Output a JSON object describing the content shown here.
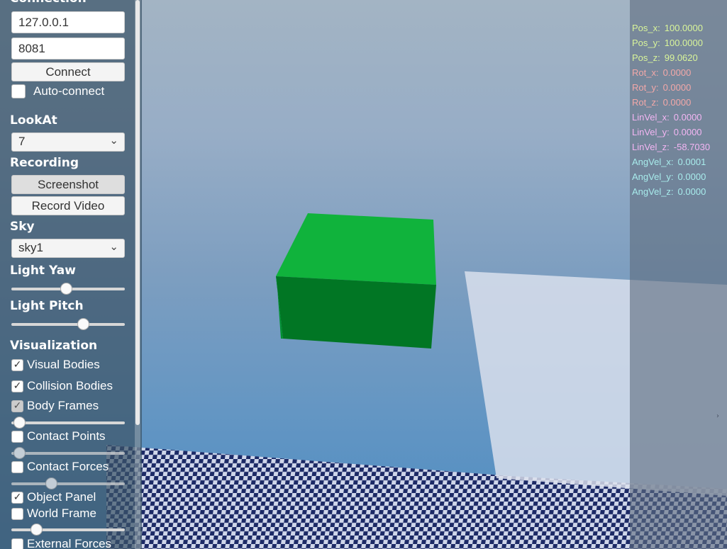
{
  "sidebar": {
    "connection": {
      "title": "Connection",
      "host": "127.0.0.1",
      "port": "8081",
      "connect_label": "Connect",
      "auto_connect_label": "Auto-connect",
      "auto_connect_checked": false
    },
    "lookat": {
      "title": "LookAt",
      "value": "7"
    },
    "recording": {
      "title": "Recording",
      "screenshot_label": "Screenshot",
      "record_video_label": "Record Video"
    },
    "sky": {
      "title": "Sky",
      "value": "sky1"
    },
    "light_yaw": {
      "title": "Light Yaw",
      "value": 0.48
    },
    "light_pitch": {
      "title": "Light Pitch",
      "value": 0.63
    },
    "visualization": {
      "title": "Visualization",
      "visual_bodies": {
        "label": "Visual Bodies",
        "checked": true
      },
      "collision_bodies": {
        "label": "Collision Bodies",
        "checked": true
      },
      "body_frames": {
        "label": "Body Frames",
        "checked": true,
        "slider": 0.07
      },
      "contact_points": {
        "label": "Contact Points",
        "checked": false,
        "slider": 0.07
      },
      "contact_forces": {
        "label": "Contact Forces",
        "checked": false,
        "slider": 0.35
      },
      "object_panel": {
        "label": "Object Panel",
        "checked": true
      },
      "world_frame": {
        "label": "World Frame",
        "checked": false,
        "slider": 0.22
      },
      "external_forces": {
        "label": "External Forces",
        "checked": false
      }
    }
  },
  "object_panel": {
    "rows": [
      {
        "label": "Pos_x:",
        "value": "100.0000",
        "color": "#d9f59a"
      },
      {
        "label": "Pos_y:",
        "value": "100.0000",
        "color": "#d9f59a"
      },
      {
        "label": "Pos_z:",
        "value": "99.0620",
        "color": "#d9f59a"
      },
      {
        "label": "Rot_x:",
        "value": "0.0000",
        "color": "#f3a8a8"
      },
      {
        "label": "Rot_y:",
        "value": "0.0000",
        "color": "#f3a8a8"
      },
      {
        "label": "Rot_z:",
        "value": "0.0000",
        "color": "#f3a8a8"
      },
      {
        "label": "LinVel_x:",
        "value": "0.0000",
        "color": "#f3b6f3"
      },
      {
        "label": "LinVel_y:",
        "value": "0.0000",
        "color": "#f3b6f3"
      },
      {
        "label": "LinVel_z:",
        "value": "-58.7030",
        "color": "#f3b6f3"
      },
      {
        "label": "AngVel_x:",
        "value": "0.0001",
        "color": "#a8ecec"
      },
      {
        "label": "AngVel_y:",
        "value": "0.0000",
        "color": "#a8ecec"
      },
      {
        "label": "AngVel_z:",
        "value": "0.0000",
        "color": "#a8ecec"
      }
    ]
  },
  "scene": {
    "box_color": "#0aa23a",
    "box_top_color": "#10b33c",
    "box_front_color": "#017624",
    "box_side_color": "#019031",
    "checker_dark": "#1c2a66",
    "checker_light": "#cfd6ea",
    "plane_color": "#dde2ee"
  }
}
